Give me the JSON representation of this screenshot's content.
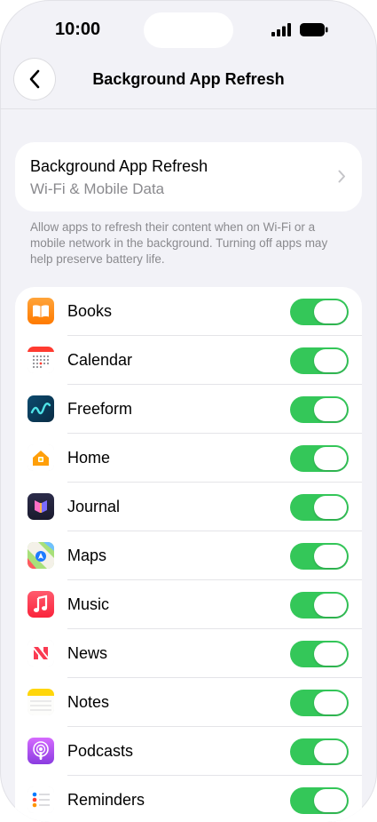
{
  "status": {
    "time": "10:00"
  },
  "nav": {
    "title": "Background App Refresh"
  },
  "setting": {
    "title": "Background App Refresh",
    "value": "Wi-Fi & Mobile Data"
  },
  "note": "Allow apps to refresh their content when on Wi-Fi or a mobile network in the background. Turning off apps may help preserve battery life.",
  "colors": {
    "toggle_on": "#34c759",
    "background": "#f2f2f7"
  },
  "apps": [
    {
      "name": "Books",
      "icon": "books-icon",
      "enabled": true
    },
    {
      "name": "Calendar",
      "icon": "calendar-icon",
      "enabled": true
    },
    {
      "name": "Freeform",
      "icon": "freeform-icon",
      "enabled": true
    },
    {
      "name": "Home",
      "icon": "home-icon",
      "enabled": true
    },
    {
      "name": "Journal",
      "icon": "journal-icon",
      "enabled": true
    },
    {
      "name": "Maps",
      "icon": "maps-icon",
      "enabled": true
    },
    {
      "name": "Music",
      "icon": "music-icon",
      "enabled": true
    },
    {
      "name": "News",
      "icon": "news-icon",
      "enabled": true
    },
    {
      "name": "Notes",
      "icon": "notes-icon",
      "enabled": true
    },
    {
      "name": "Podcasts",
      "icon": "podcasts-icon",
      "enabled": true
    },
    {
      "name": "Reminders",
      "icon": "reminders-icon",
      "enabled": true
    }
  ]
}
